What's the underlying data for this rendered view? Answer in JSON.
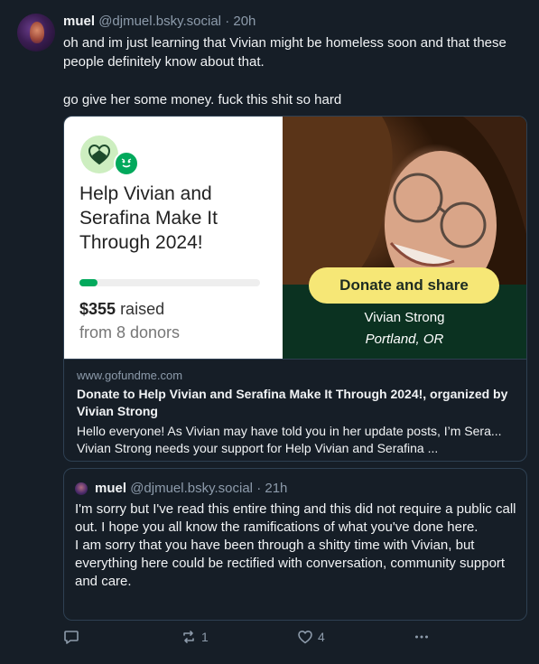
{
  "post": {
    "author_name": "muel",
    "author_handle": "@djmuel.bsky.social",
    "separator": "·",
    "time": "20h",
    "text_lines": [
      "oh and im just learning that Vivian might be homeless soon and that these people definitely know about that.",
      "go give her some money. fuck this shit so hard"
    ]
  },
  "embed": {
    "campaign_title": "Help Vivian and Serafina Make It Through 2024!",
    "progress_fraction": 0.1,
    "raised_amount": "$355",
    "raised_label": "raised",
    "donors": "from 8 donors",
    "donate_button": "Donate and share",
    "organizer": "Vivian Strong",
    "location": "Portland, OR",
    "domain": "www.gofundme.com",
    "link_title": "Donate to Help Vivian and Serafina Make It Through 2024!, organized by Vivian Strong",
    "link_description": "Hello everyone! As Vivian may have told you in her update posts, I’m Sera... Vivian Strong needs your support for Help Vivian and Serafina ...",
    "brand_green": "#02a95c",
    "button_yellow": "#f6e776"
  },
  "quote": {
    "author_name": "muel",
    "author_handle": "@djmuel.bsky.social",
    "separator": "·",
    "time": "21h",
    "text_lines": [
      "I'm sorry but I've read this entire thing and this did not require a public call out. I hope you all know the ramifications of what you've done here.",
      "I am sorry that you have been through a shitty time with Vivian, but everything here could be rectified with conversation, community support and care."
    ]
  },
  "actions": {
    "reply_icon": "reply-icon",
    "repost_count": "1",
    "like_count": "4",
    "more_icon": "more-icon"
  },
  "colors": {
    "background": "#161e27",
    "border": "#2e4052",
    "muted_text": "#8d9bab"
  }
}
